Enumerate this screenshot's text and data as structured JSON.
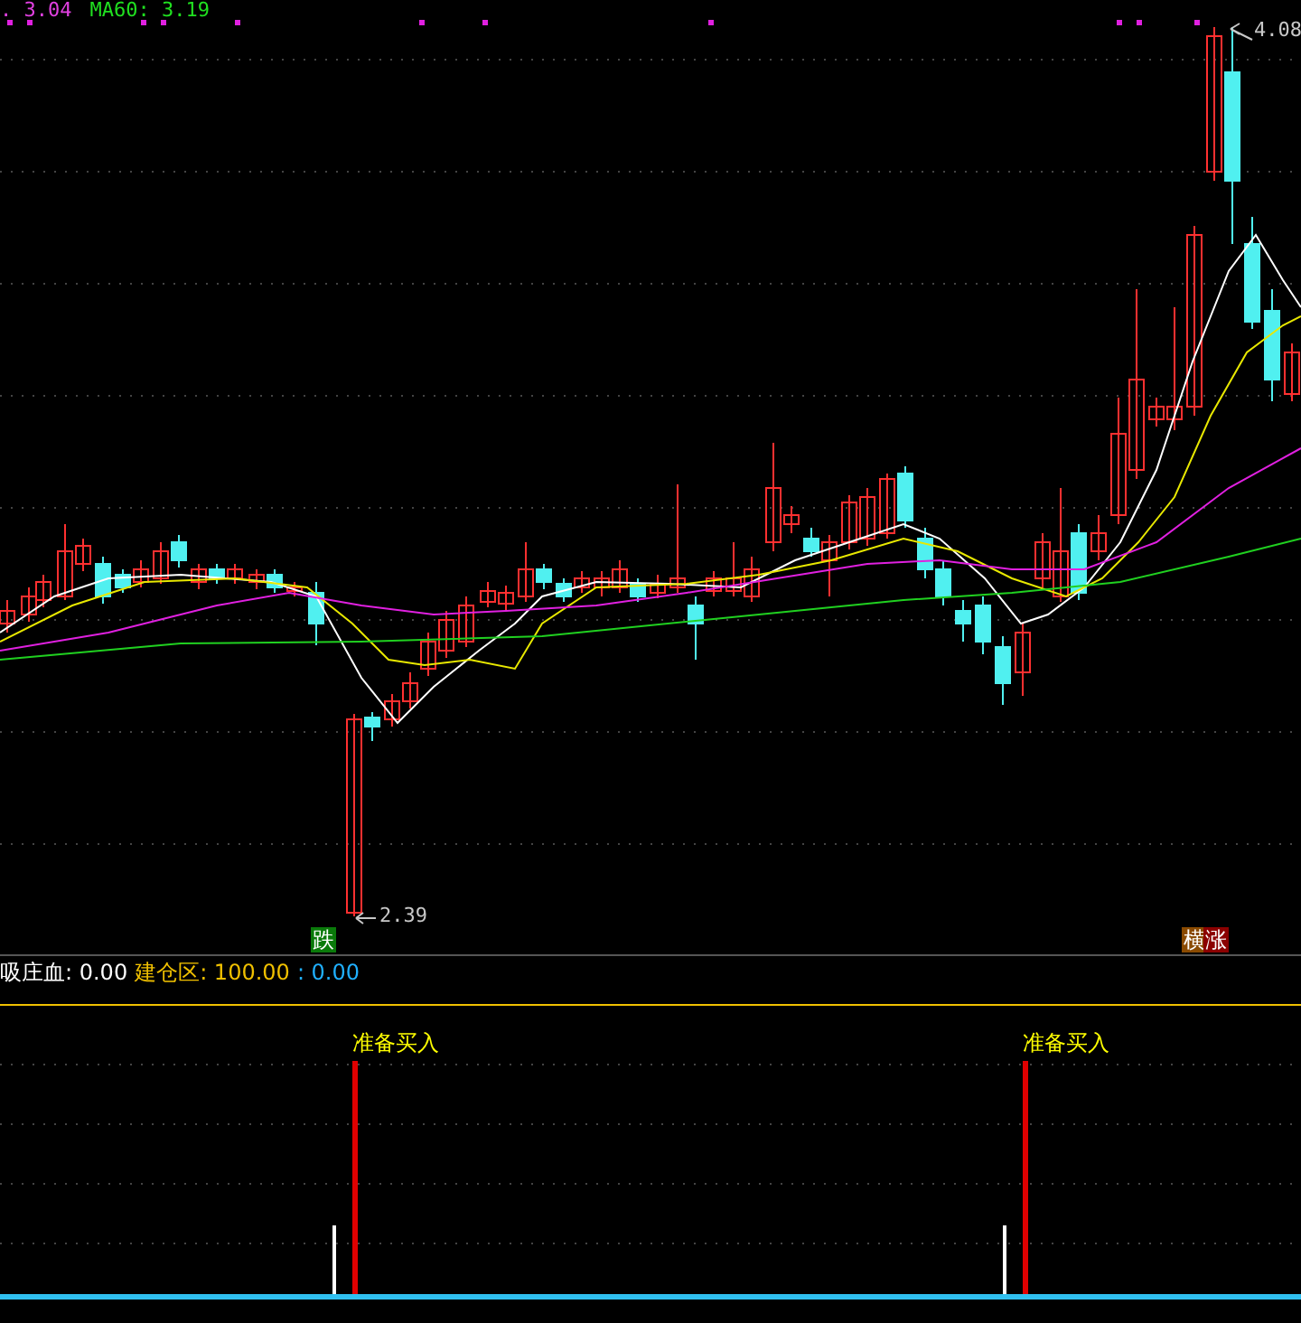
{
  "main_chart": {
    "legend": [
      {
        "text": ". 3.04",
        "color": "#e040e0"
      },
      {
        "text": "MA60: 3.19",
        "color": "#20e020"
      }
    ],
    "high_label": "4.08",
    "low_label": "2.39",
    "markers": [
      {
        "text": "跌",
        "color": "#0a7a0a"
      },
      {
        "text": "横",
        "color": "#8a4a00"
      },
      {
        "text": "涨",
        "color": "#8b0000"
      }
    ]
  },
  "indicator": {
    "legend": [
      {
        "text": "吸庄血: 0.00",
        "color": "#ffffff"
      },
      {
        "text": "建仓区: 100.00",
        "color": "#f0c000"
      },
      {
        "text": ": 0.00",
        "color": "#20b0ff"
      }
    ],
    "signals": [
      {
        "label": "准备买入"
      },
      {
        "label": "准备买入"
      }
    ]
  }
}
